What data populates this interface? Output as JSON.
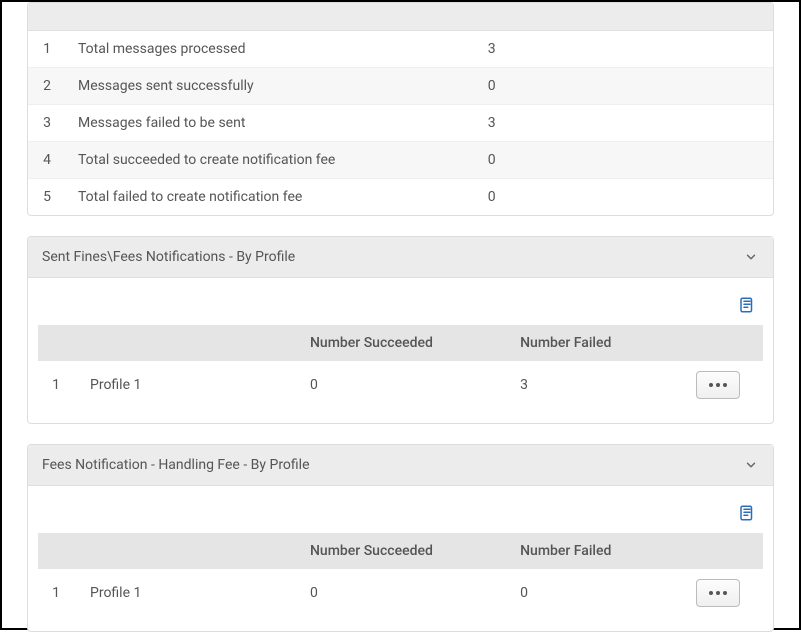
{
  "summary": {
    "rows": [
      {
        "idx": "1",
        "label": "Total messages processed",
        "value": "3"
      },
      {
        "idx": "2",
        "label": "Messages sent successfully",
        "value": "0"
      },
      {
        "idx": "3",
        "label": "Messages failed to be sent",
        "value": "3"
      },
      {
        "idx": "4",
        "label": "Total succeeded to create notification fee",
        "value": "0"
      },
      {
        "idx": "5",
        "label": "Total failed to create notification fee",
        "value": "0"
      }
    ]
  },
  "panels": [
    {
      "title": "Sent Fines\\Fees Notifications - By Profile",
      "columns": {
        "succeeded": "Number Succeeded",
        "failed": "Number Failed"
      },
      "rows": [
        {
          "idx": "1",
          "name": "Profile 1",
          "succeeded": "0",
          "failed": "3"
        }
      ]
    },
    {
      "title": "Fees Notification - Handling Fee - By Profile",
      "columns": {
        "succeeded": "Number Succeeded",
        "failed": "Number Failed"
      },
      "rows": [
        {
          "idx": "1",
          "name": "Profile 1",
          "succeeded": "0",
          "failed": "0"
        }
      ]
    }
  ]
}
